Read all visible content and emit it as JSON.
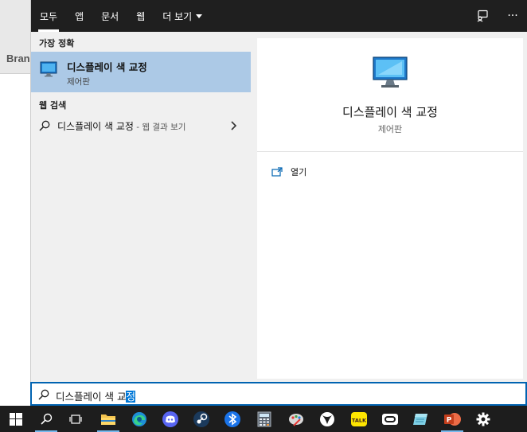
{
  "background_app": {
    "label": "Bran"
  },
  "tabs": [
    {
      "label": "모두",
      "active": true
    },
    {
      "label": "앱",
      "active": false
    },
    {
      "label": "문서",
      "active": false
    },
    {
      "label": "웹",
      "active": false
    },
    {
      "label": "더 보기",
      "active": false,
      "dropdown": true
    }
  ],
  "top_icons": [
    "feedback-icon",
    "more-options-icon"
  ],
  "more_glyph": "···",
  "best_match": {
    "header": "가장 정확",
    "title": "디스플레이 색 교정",
    "subtitle": "제어판",
    "icon": "monitor-icon"
  },
  "web_search": {
    "header": "웹 검색",
    "query": "디스플레이 색 교정",
    "suffix": " - 웹 결과 보기"
  },
  "detail": {
    "title": "디스플레이 색 교정",
    "subtitle": "제어판",
    "actions": [
      {
        "label": "열기",
        "icon": "open-icon"
      }
    ]
  },
  "search_box": {
    "typed": "디스플레이 색 교",
    "selected": "정"
  },
  "taskbar": [
    "windows-start-icon",
    "search-icon",
    "task-view-icon",
    "file-explorer-icon",
    "edge-icon",
    "discord-icon",
    "steam-icon",
    "bluetooth-app-icon",
    "calculator-icon",
    "paint-icon",
    "xbox-icon",
    "kakaotalk-icon",
    "camera-app-icon",
    "notes-icon",
    "powerpoint-icon",
    "settings-icon"
  ],
  "kakao_label": "TALK",
  "powerpoint_letter": "P",
  "colors": {
    "accent": "#0078d7",
    "selection_bg": "#acc9e6",
    "topbar": "#1f1f1f",
    "taskbar": "#1d1d1d"
  }
}
